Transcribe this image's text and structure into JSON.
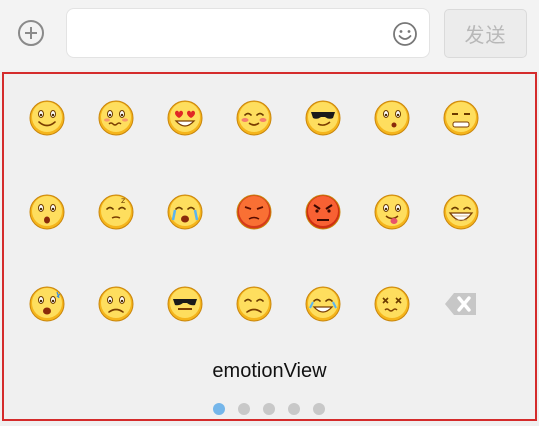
{
  "toolbar": {
    "send_label": "发送",
    "input_value": "",
    "plus_icon": "plus-circle-icon",
    "emoji_icon": "smiley-outline-icon"
  },
  "emotion_panel": {
    "caption": "emotionView",
    "emojis": [
      [
        "smile",
        "shy-wavy",
        "heart-eyes",
        "blush-laugh",
        "sunglasses",
        "whistle",
        "grimace"
      ],
      [
        "surprised",
        "sleepy",
        "crying",
        "angry-red",
        "furious",
        "tongue",
        "big-grin"
      ],
      [
        "scared",
        "sad",
        "cool-mask",
        "relieved",
        "laughing-tears",
        "dizzy",
        "backspace"
      ]
    ],
    "page_count": 5,
    "active_page": 1,
    "border_color": "#d42b2b",
    "active_dot_color": "#75b6ea"
  }
}
